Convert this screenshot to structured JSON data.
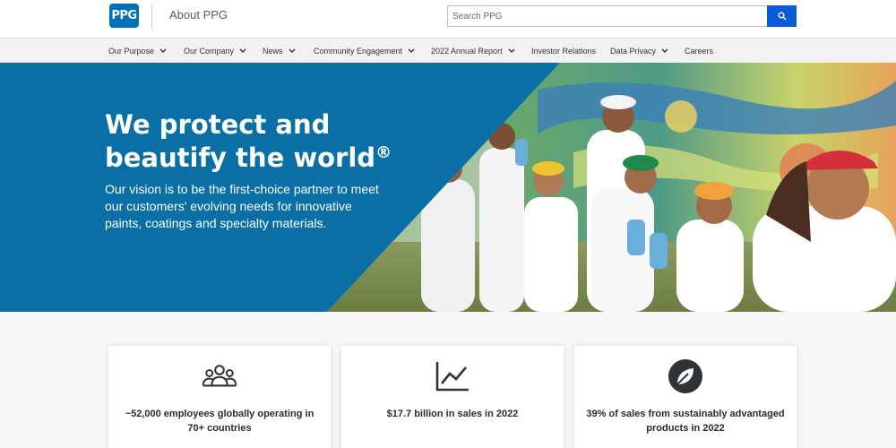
{
  "header": {
    "logo_text": "PPG",
    "site_title": "About PPG",
    "search_placeholder": "Search PPG",
    "search_icon": "search-icon"
  },
  "nav": {
    "items": [
      {
        "label": "Our Purpose",
        "has_dropdown": true
      },
      {
        "label": "Our Company",
        "has_dropdown": true
      },
      {
        "label": "News",
        "has_dropdown": true
      },
      {
        "label": "Community Engagement",
        "has_dropdown": true
      },
      {
        "label": "2022 Annual Report",
        "has_dropdown": true
      },
      {
        "label": "Investor Relations",
        "has_dropdown": false
      },
      {
        "label": "Data Privacy",
        "has_dropdown": true
      },
      {
        "label": "Careers",
        "has_dropdown": false
      }
    ]
  },
  "hero": {
    "headline": "We protect and beautify the world",
    "registered_mark": "®",
    "body": "Our vision is to be the first-choice partner to meet our customers' evolving needs for innovative paints, coatings and specialty materials."
  },
  "stats": [
    {
      "icon": "people-group-icon",
      "text": "~52,000 employees globally operating in 70+ countries"
    },
    {
      "icon": "line-chart-icon",
      "text": "$17.7 billion in sales in 2022"
    },
    {
      "icon": "leaf-icon",
      "text": "39% of sales from sustainably advantaged products in 2022"
    }
  ],
  "colors": {
    "brand_blue": "#0070b8",
    "hero_blue": "#0a6fa5",
    "search_button": "#0a5cd6"
  }
}
